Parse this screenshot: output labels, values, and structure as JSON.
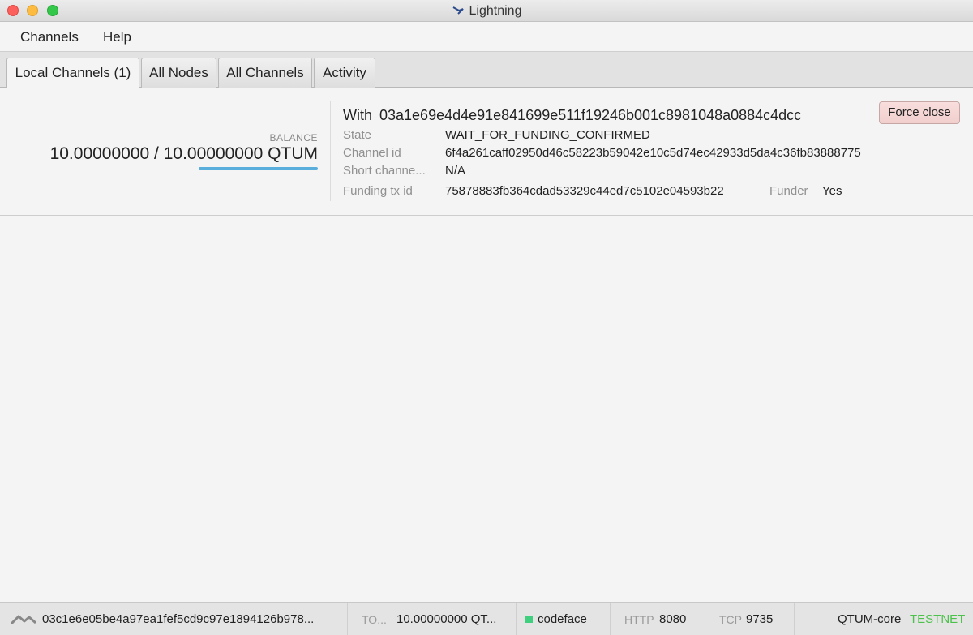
{
  "window": {
    "title": "Lightning"
  },
  "menubar": {
    "items": [
      "Channels",
      "Help"
    ]
  },
  "tabs": [
    {
      "label": "Local Channels (1)",
      "active": true
    },
    {
      "label": "All Nodes",
      "active": false
    },
    {
      "label": "All Channels",
      "active": false
    },
    {
      "label": "Activity",
      "active": false
    }
  ],
  "channel": {
    "balance_label": "BALANCE",
    "balance_value": "10.00000000 / 10.00000000 QTUM",
    "balance_fraction": 1.0,
    "with_label": "With",
    "peer_id": "03a1e69e4d4e91e841699e511f19246b001c8981048a0884c4dcc",
    "force_close_label": "Force close",
    "state_label": "State",
    "state_value": "WAIT_FOR_FUNDING_CONFIRMED",
    "channel_id_label": "Channel id",
    "channel_id_value": "6f4a261caff02950d46c58223b59042e10c5d74ec42933d5da4c36fb83888775",
    "short_channel_label": "Short channe...",
    "short_channel_value": "N/A",
    "funding_tx_label": "Funding tx id",
    "funding_tx_value": "75878883fb364cdad53329c44ed7c5102e04593b22",
    "funder_label": "Funder",
    "funder_value": "Yes"
  },
  "statusbar": {
    "node_id": "03c1e6e05be4a97ea1fef5cd9c97e1894126b978...",
    "total_label": "TO...",
    "total_value": "10.00000000 QT...",
    "alias": "codeface",
    "http_label": "HTTP",
    "http_port": "8080",
    "tcp_label": "TCP",
    "tcp_port": "9735",
    "backend": "QTUM-core",
    "network": "TESTNET",
    "network_color": "#4cc24c",
    "alias_dot_color": "#3fcf7e"
  },
  "colors": {
    "balance_bar": "#5aaedb",
    "force_close_bg": "#f4d6d4"
  }
}
